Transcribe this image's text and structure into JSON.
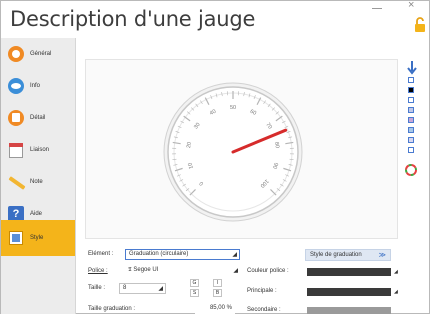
{
  "window": {
    "title": "Description d'une jauge",
    "close_glyph": "×"
  },
  "sidebar": {
    "items": [
      {
        "label": "Général",
        "icon": "general-icon"
      },
      {
        "label": "Info",
        "icon": "info-icon"
      },
      {
        "label": "Détail",
        "icon": "detail-icon"
      },
      {
        "label": "Liaison",
        "icon": "liaison-icon"
      },
      {
        "label": "Note",
        "icon": "note-icon"
      },
      {
        "label": "Aide",
        "icon": "help-icon"
      },
      {
        "label": "Style",
        "icon": "style-icon",
        "active": true
      }
    ]
  },
  "gauge": {
    "ticks": [
      "0",
      "10",
      "20",
      "30",
      "40",
      "50",
      "60",
      "70",
      "80",
      "90",
      "100"
    ],
    "needle_value": 75,
    "needle_color": "#d62b2b"
  },
  "palette": {
    "swatches": [
      "#ffffff",
      "#000000",
      "#ffffff",
      "#c0c8e8",
      "#c8a8d8",
      "#a8c8e8",
      "#d8d8f0",
      "#ffffff"
    ]
  },
  "properties": {
    "element_label": "Elément :",
    "element_value": "Graduation (circulaire)",
    "style_button": "Style de graduation",
    "police_label": "Police :",
    "police_value": "Segoe UI",
    "taille_label": "Taille :",
    "taille_value": "8",
    "gras_label": "G",
    "italique_label": "I",
    "souligne_label": "S",
    "barre_label": "B",
    "couleur_police_label": "Couleur police :",
    "principale_label": "Principale :",
    "taille_graduation_label": "Taille graduation :",
    "taille_graduation_value": "85,00 %",
    "secondaire_label": "Secondaire :"
  },
  "colors": {
    "accent": "#f4b41a",
    "link_blue": "#4a7bd0"
  }
}
